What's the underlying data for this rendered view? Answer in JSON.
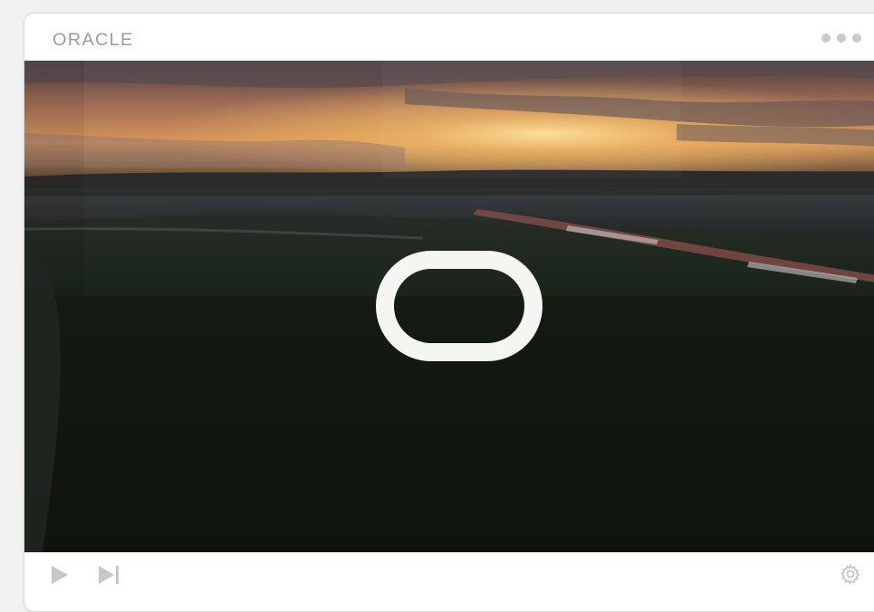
{
  "player": {
    "brand": "ORACLE",
    "menu_icon": "more-dots-icon",
    "video": {
      "overlay_icon": "oracle-logo-icon",
      "scene": "sunset-landscape"
    },
    "controls": {
      "play_icon": "play-icon",
      "next_icon": "skip-next-icon",
      "settings_icon": "gear-icon"
    }
  },
  "colors": {
    "icon_gray": "#c7c7c7",
    "brand_gray": "#9a9a9a",
    "sky_glow": "#f2b860"
  }
}
